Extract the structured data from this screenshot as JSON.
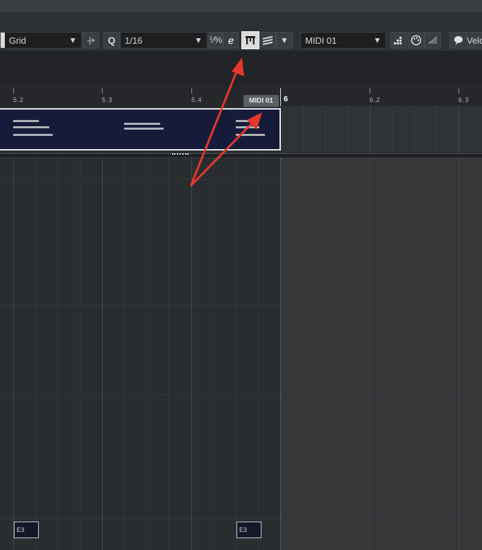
{
  "toolbar": {
    "snap_type": "Grid",
    "quantize_label": "Q",
    "quantize_value": "1/16",
    "track_name": "MIDI 01",
    "velocity_label": "Velo"
  },
  "ruler": {
    "labels": [
      "5.2",
      "5.3",
      "5.4",
      "6",
      "6.2",
      "6.3"
    ]
  },
  "part": {
    "name": "MIDI 01"
  },
  "notes": [
    {
      "label": "E3"
    },
    {
      "label": "E3"
    }
  ],
  "annotation": {
    "arrow_color": "#e5392b"
  }
}
